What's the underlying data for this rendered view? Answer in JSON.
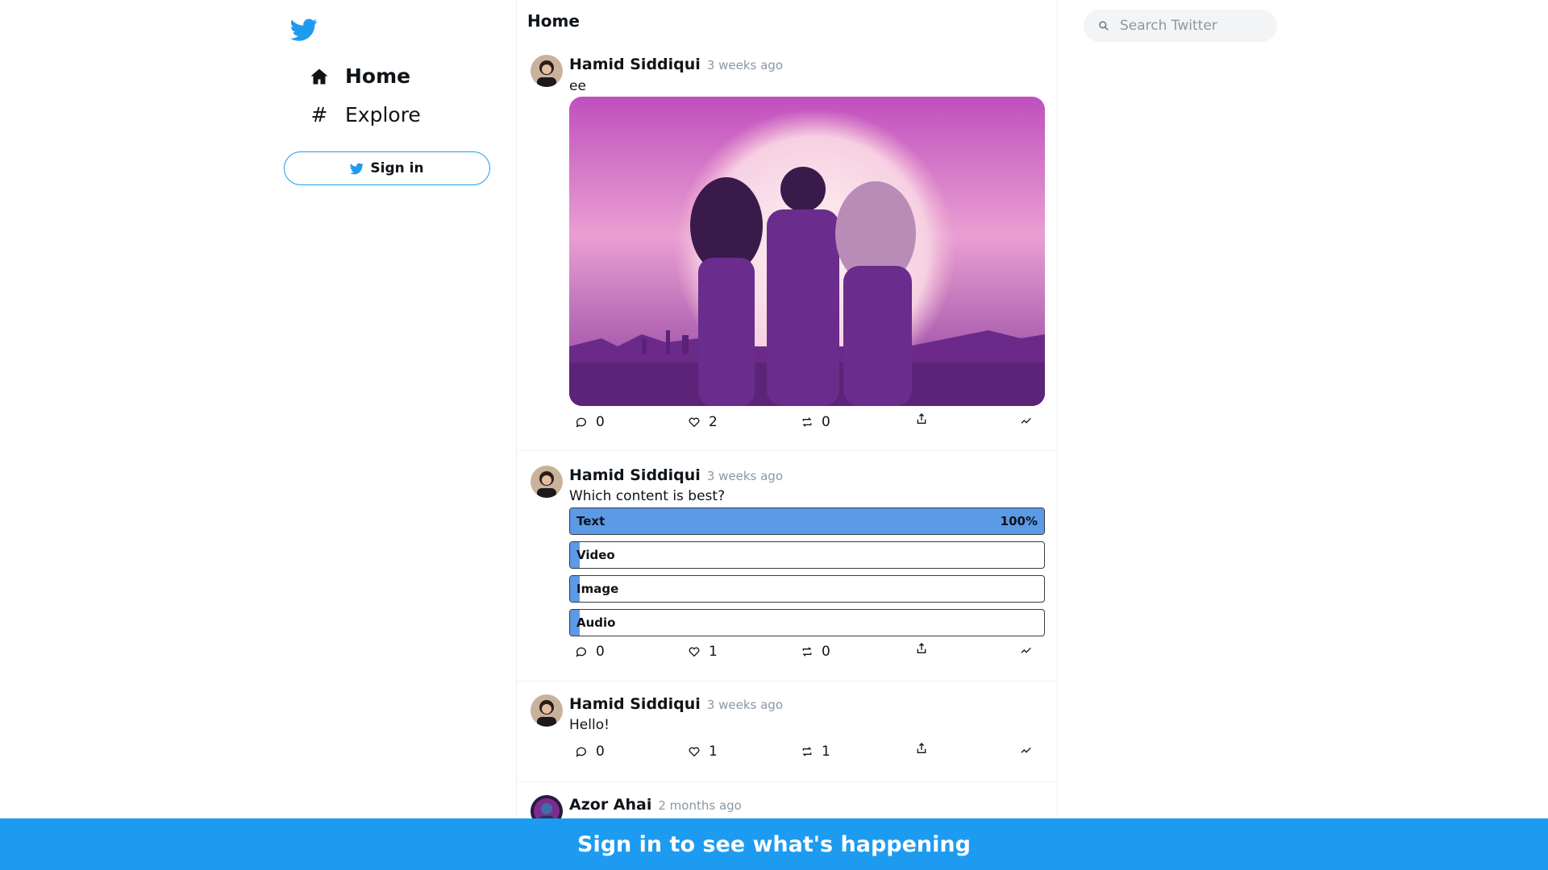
{
  "app": {
    "brand_color": "#1d9bf0"
  },
  "sidebar": {
    "logo": "twitter-bird-icon",
    "nav": [
      {
        "label": "Home",
        "icon": "home-icon",
        "active": true
      },
      {
        "label": "Explore",
        "icon": "hashtag-icon",
        "active": false
      }
    ],
    "signin_label": "Sign in"
  },
  "feed": {
    "title": "Home",
    "tweets": [
      {
        "author": "Hamid Siddiqui",
        "time": "3 weeks ago",
        "text": "ee",
        "media": "image",
        "stats": {
          "comments": "0",
          "likes": "2",
          "retweets": "0"
        }
      },
      {
        "author": "Hamid Siddiqui",
        "time": "3 weeks ago",
        "text": "Which content is best?",
        "poll": [
          {
            "label": "Text",
            "percent": 100,
            "percent_label": "100%"
          },
          {
            "label": "Video",
            "percent": 0,
            "percent_label": ""
          },
          {
            "label": "Image",
            "percent": 0,
            "percent_label": ""
          },
          {
            "label": "Audio",
            "percent": 0,
            "percent_label": ""
          }
        ],
        "stats": {
          "comments": "0",
          "likes": "1",
          "retweets": "0"
        }
      },
      {
        "author": "Hamid Siddiqui",
        "time": "3 weeks ago",
        "text": "Hello!",
        "stats": {
          "comments": "0",
          "likes": "1",
          "retweets": "1"
        }
      },
      {
        "author": "Azor Ahai",
        "time": "2 months ago"
      }
    ]
  },
  "search": {
    "placeholder": "Search Twitter"
  },
  "banner": {
    "text": "Sign in to see what's happening"
  }
}
